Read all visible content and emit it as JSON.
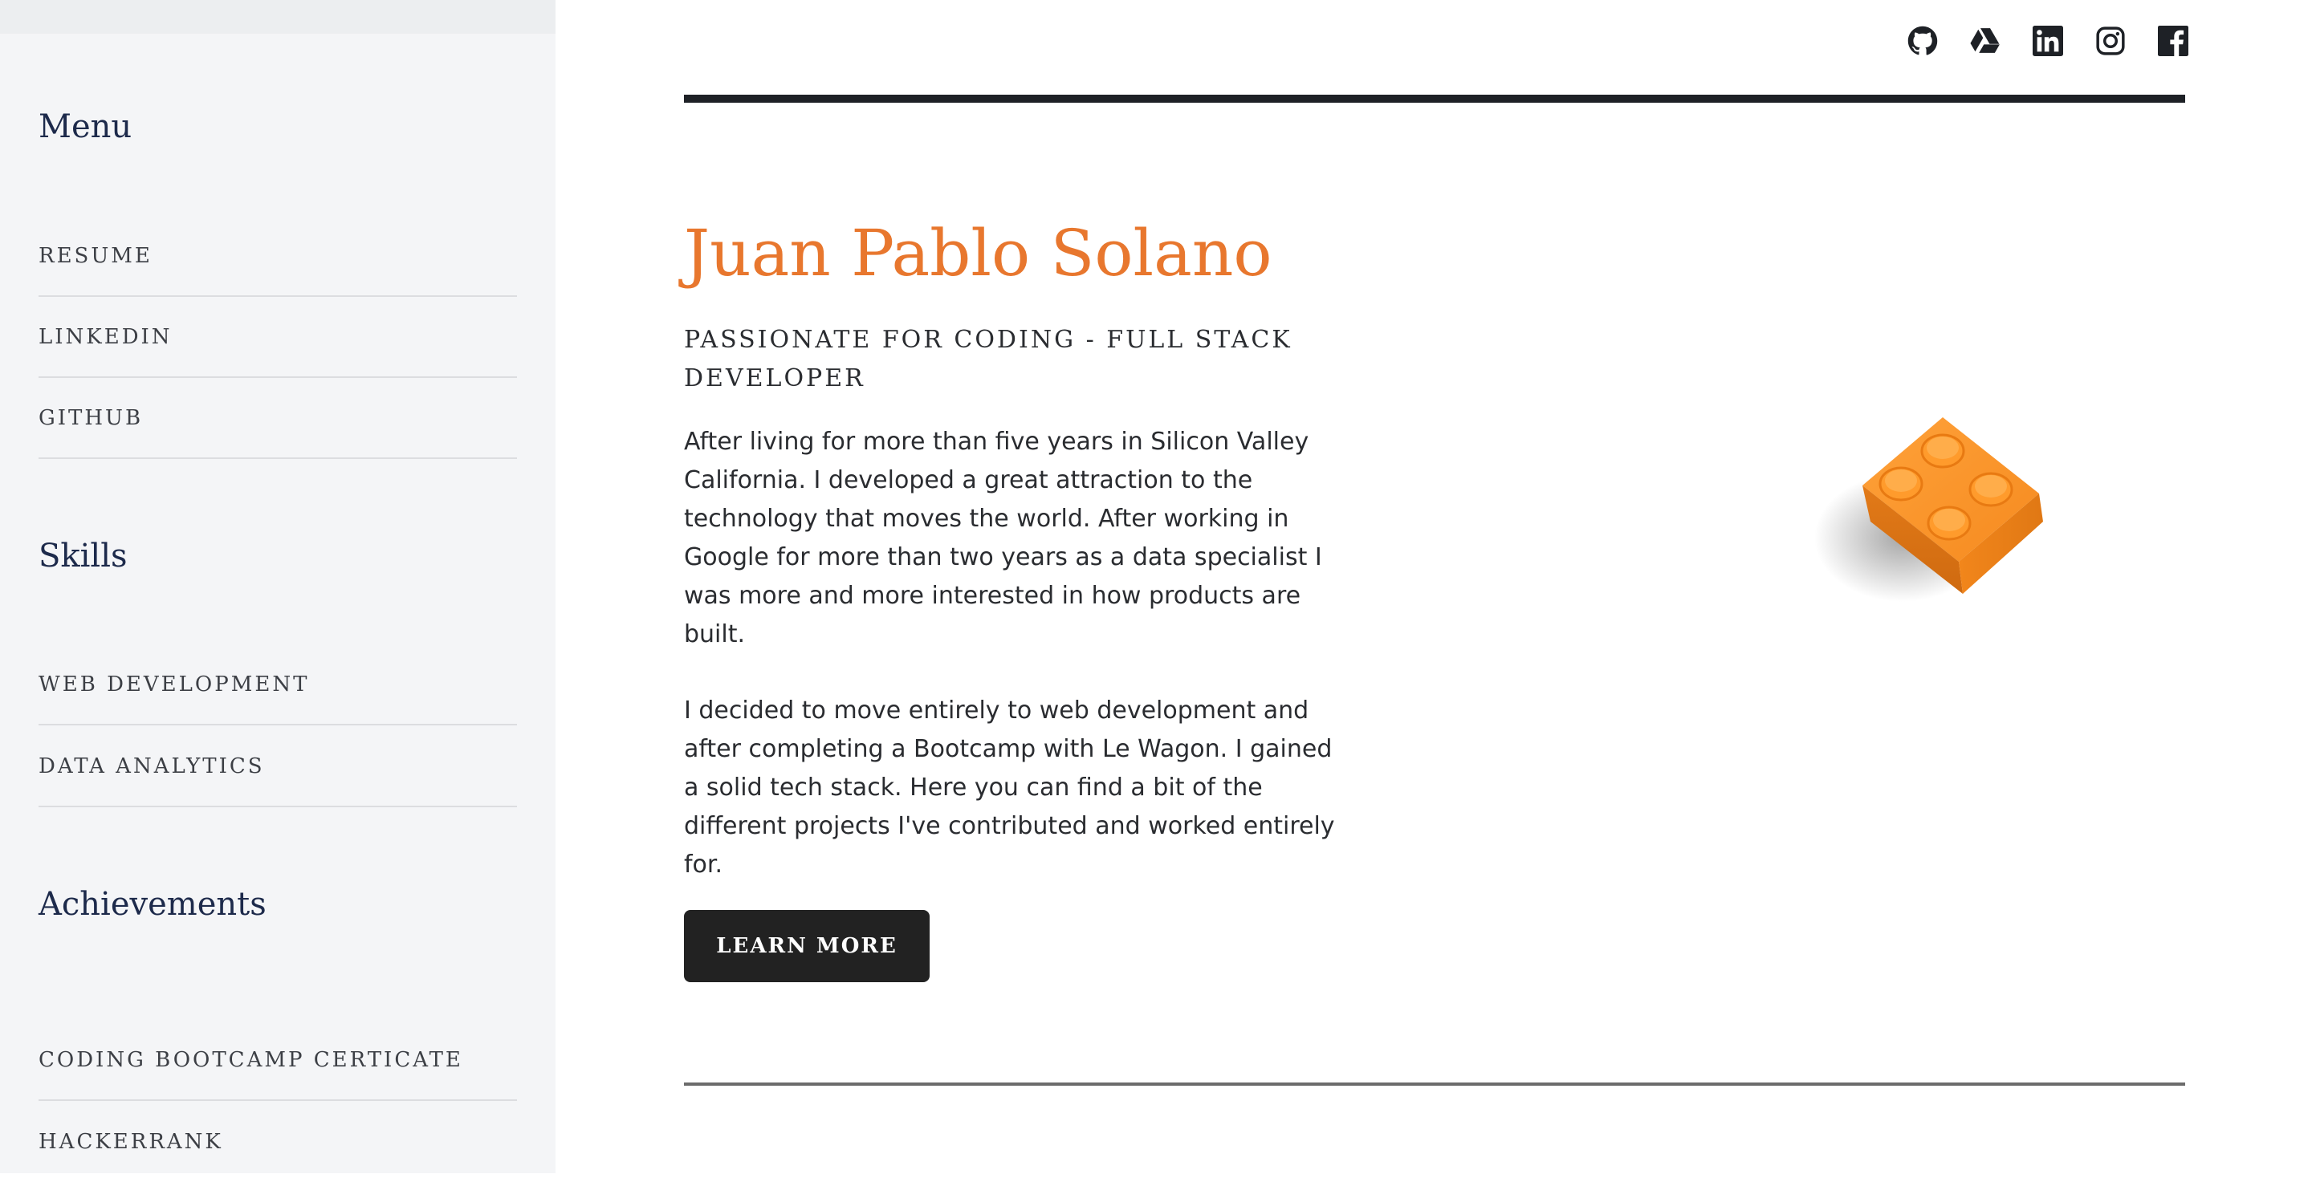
{
  "sidebar": {
    "sections": [
      {
        "heading": "Menu",
        "items": [
          {
            "label": "RESUME"
          },
          {
            "label": "LINKEDIN"
          },
          {
            "label": "GITHUB"
          }
        ]
      },
      {
        "heading": "Skills",
        "items": [
          {
            "label": "WEB DEVELOPMENT"
          },
          {
            "label": "DATA ANALYTICS"
          }
        ]
      },
      {
        "heading": "Achievements",
        "items": [
          {
            "label": "CODING BOOTCAMP CERTICATE"
          },
          {
            "label": "HACKERRANK"
          }
        ]
      }
    ]
  },
  "header": {
    "social_icons": [
      "github-icon",
      "google-drive-icon",
      "linkedin-icon",
      "instagram-icon",
      "facebook-icon"
    ]
  },
  "hero": {
    "title": "Juan Pablo Solano",
    "subtitle": "PASSIONATE FOR CODING - FULL STACK DEVELOPER",
    "paragraph_1": "After living for more than five years in Silicon Valley California. I developed a great attraction to the technology that moves the world. After working in Google for more than two years as a data specialist I was more and more interested in how products are built.",
    "paragraph_2": "I decided to move entirely to web development and after completing a Bootcamp with Le Wagon. I gained a solid tech stack. Here you can find a bit of the different projects I've contributed and worked entirely for.",
    "button_label": "LEARN MORE"
  },
  "colors": {
    "accent": "#e8772e",
    "heading": "#1d2a4b",
    "dark": "#222222",
    "sidebar_bg": "#f4f5f7"
  }
}
